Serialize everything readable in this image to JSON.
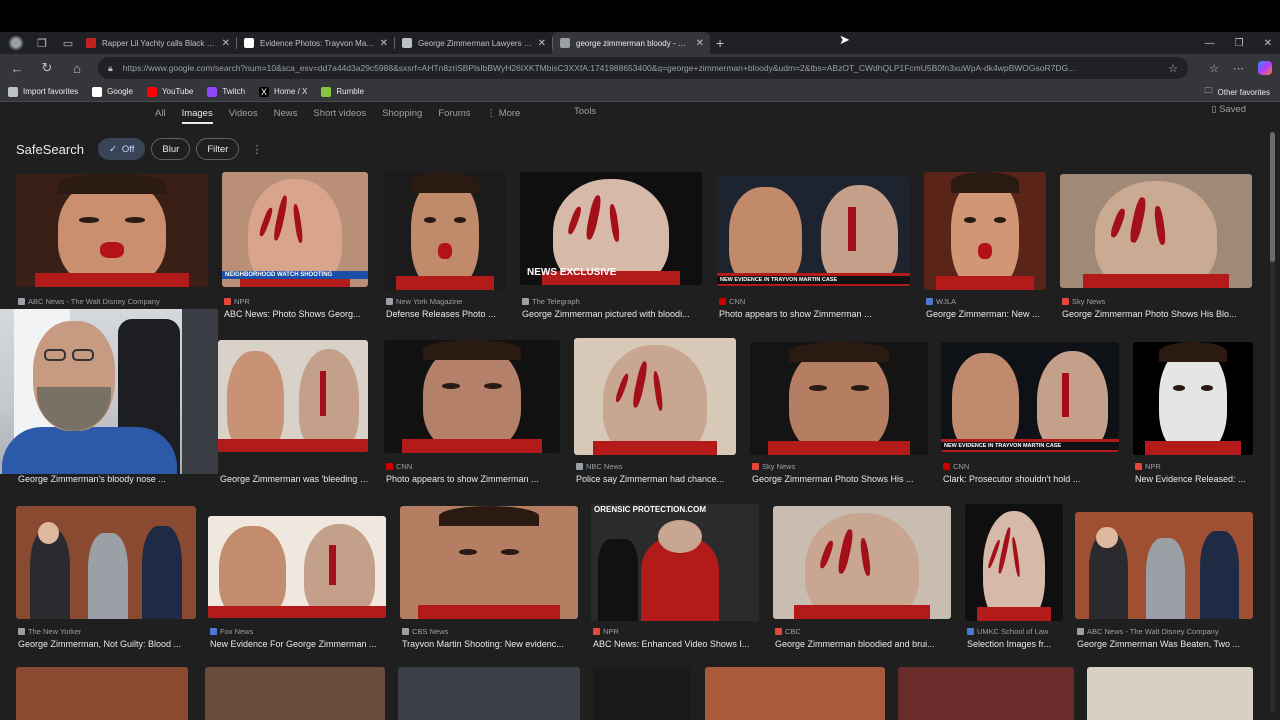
{
  "browser": {
    "tabs": [
      {
        "title": "Rapper Lil Yachty calls Black Lives",
        "fav": "#c5221f",
        "active": false
      },
      {
        "title": "Evidence Photos: Trayvon Martin",
        "fav": "#ffffff",
        "active": false
      },
      {
        "title": "George Zimmerman Lawyers Say",
        "fav": "#bdc1c6",
        "active": false
      },
      {
        "title": "george zimmerman bloody - Goo",
        "fav": "#9aa0a6",
        "active": true
      }
    ],
    "url": "https://www.google.com/search?num=10&sca_esv=dd7a44d3a29c5988&sxsrf=AHTn8zriSBPlsIbBWyH26IXKTMbisC3XXfA:1741988653400&q=george+zimmerman+bloody&udm=2&tbs=ABzOT_CWdhQLP1FcmU5B0fn3xuWpA-dk4wpBWOGsoR7DG...",
    "bookmarks": [
      {
        "label": "Import favorites",
        "color": "#bdc1c6"
      },
      {
        "label": "Google",
        "color": "#ffffff"
      },
      {
        "label": "YouTube",
        "color": "#ff0000"
      },
      {
        "label": "Twitch",
        "color": "#9146ff"
      },
      {
        "label": "Home / X",
        "color": "#000000"
      },
      {
        "label": "Rumble",
        "color": "#85c742"
      }
    ],
    "other_favorites": "Other favorites"
  },
  "search": {
    "tabs": [
      "All",
      "Images",
      "Videos",
      "News",
      "Short videos",
      "Shopping",
      "Forums",
      "More"
    ],
    "active_tab": "Images",
    "tools": "Tools",
    "saved": "Saved",
    "safesearch": {
      "label": "SafeSearch",
      "off": "Off",
      "blur": "Blur",
      "filter": "Filter"
    }
  },
  "results": [
    {
      "source": "ABC News - The Walt Disney Company",
      "caption": "",
      "srcColor": "#9aa0a6"
    },
    {
      "source": "NPR",
      "caption": "ABC News: Photo Shows Georg...",
      "srcColor": "#e8453c"
    },
    {
      "source": "New York Magazine",
      "caption": "Defense Releases Photo ...",
      "srcColor": "#9aa0a6"
    },
    {
      "source": "The Telegraph",
      "caption": "George Zimmerman pictured with bloodi...",
      "srcColor": "#9aa0a6"
    },
    {
      "source": "CNN",
      "caption": "Photo appears to show Zimmerman ...",
      "srcColor": "#cc0000"
    },
    {
      "source": "WJLA",
      "caption": "George Zimmerman: New ...",
      "srcColor": "#4a7bd0"
    },
    {
      "source": "Sky News",
      "caption": "George Zimmerman Photo Shows His Blo...",
      "srcColor": "#e8453c"
    },
    {
      "source": "",
      "caption": "George Zimmerman's bloody nose ...",
      "srcColor": "#9aa0a6"
    },
    {
      "source": "",
      "caption": "George Zimmerman was 'bleeding fro...",
      "srcColor": "#9aa0a6"
    },
    {
      "source": "CNN",
      "caption": "Photo appears to show Zimmerman ...",
      "srcColor": "#cc0000"
    },
    {
      "source": "NBC News",
      "caption": "Police say Zimmerman had chance...",
      "srcColor": "#9aa0a6"
    },
    {
      "source": "Sky News",
      "caption": "George Zimmerman Photo Shows His ...",
      "srcColor": "#e8453c"
    },
    {
      "source": "CNN",
      "caption": "Clark: Prosecutor shouldn't hold ...",
      "srcColor": "#cc0000"
    },
    {
      "source": "NPR",
      "caption": "New Evidence Released: ...",
      "srcColor": "#e8453c"
    },
    {
      "source": "The New Yorker",
      "caption": "George Zimmerman, Not Guilty: Blood ...",
      "srcColor": "#9aa0a6"
    },
    {
      "source": "Fox News",
      "caption": "New Evidence For George Zimmerman ...",
      "srcColor": "#4a7bd0"
    },
    {
      "source": "CBS News",
      "caption": "Trayvon Martin Shooting: New evidenc...",
      "srcColor": "#9aa0a6"
    },
    {
      "source": "NPR",
      "caption": "ABC News: Enhanced Video Shows I...",
      "srcColor": "#e8453c"
    },
    {
      "source": "CBC",
      "caption": "George Zimmerman bloodied and brui...",
      "srcColor": "#e8453c"
    },
    {
      "source": "UMKC School of Law",
      "caption": "Selection Images fr...",
      "srcColor": "#4a7bd0"
    },
    {
      "source": "ABC News - The Walt Disney Company",
      "caption": "George Zimmerman Was Beaten, Two ...",
      "srcColor": "#9aa0a6"
    }
  ],
  "overlays": {
    "news_exclusive": "NEWS EXCLUSIVE",
    "exclusive": "EXCLUSIVE",
    "neighborhood_watch": "NEIGHBORHOOD WATCH SHOOTING",
    "new_evidence": "NEW EVIDENCE IN TRAYVON MARTIN CASE",
    "cnn": "CNN",
    "forensic": "ORENSIC PROTECTION.COM"
  }
}
